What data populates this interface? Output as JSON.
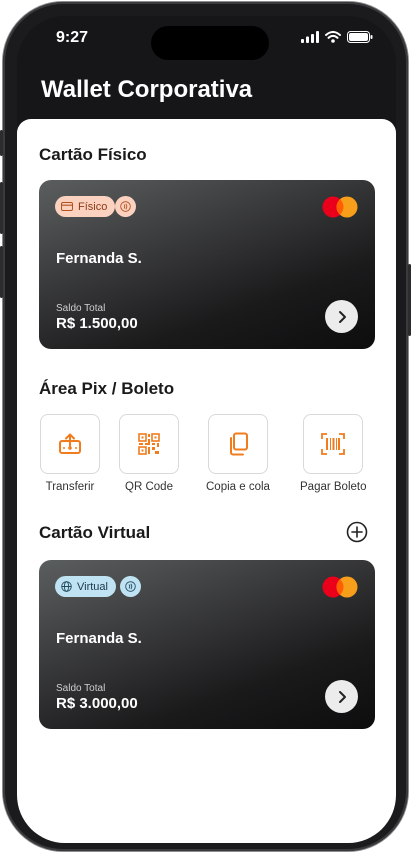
{
  "status": {
    "time": "9:27"
  },
  "header": {
    "title": "Wallet Corporativa"
  },
  "physical": {
    "section_title": "Cartão Físico",
    "badge": "Físico",
    "holder": "Fernanda S.",
    "balance_label": "Saldo Total",
    "balance": "R$ 1.500,00"
  },
  "pix": {
    "section_title": "Área Pix / Boleto",
    "actions": [
      {
        "label": "Transferir",
        "icon": "transfer-icon"
      },
      {
        "label": "QR Code",
        "icon": "qr-code-icon"
      },
      {
        "label": "Copia e cola",
        "icon": "copy-icon"
      },
      {
        "label": "Pagar Boleto",
        "icon": "barcode-icon"
      }
    ]
  },
  "virtual": {
    "section_title": "Cartão Virtual",
    "badge": "Virtual",
    "holder": "Fernanda S.",
    "balance_label": "Saldo Total",
    "balance": "R$ 3.000,00"
  },
  "colors": {
    "accent": "#f07c1e",
    "physical_badge_bg": "#fbd2bf",
    "virtual_badge_bg": "#bfe3f3",
    "mc_red": "#eb001b",
    "mc_orange": "#f79e1b"
  }
}
